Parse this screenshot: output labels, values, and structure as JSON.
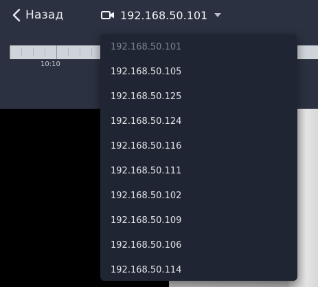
{
  "header": {
    "back_label": "Назад",
    "camera_label": "192.168.50.101"
  },
  "timeline": {
    "label": "10:10"
  },
  "dropdown": {
    "items": [
      {
        "label": "192.168.50.101",
        "selected": true
      },
      {
        "label": "192.168.50.105"
      },
      {
        "label": "192.168.50.125"
      },
      {
        "label": "192.168.50.124"
      },
      {
        "label": "192.168.50.116"
      },
      {
        "label": "192.168.50.111"
      },
      {
        "label": "192.168.50.102"
      },
      {
        "label": "192.168.50.109"
      },
      {
        "label": "192.168.50.106"
      },
      {
        "label": "192.168.50.114"
      }
    ]
  },
  "icons": {
    "back": "chevron-left-icon",
    "camera": "video-camera-icon",
    "caret": "caret-down-icon"
  },
  "colors": {
    "panel": "#2b3140",
    "dropdown": "#1f2532",
    "text": "#e6e9ee",
    "muted": "#7d8390"
  }
}
